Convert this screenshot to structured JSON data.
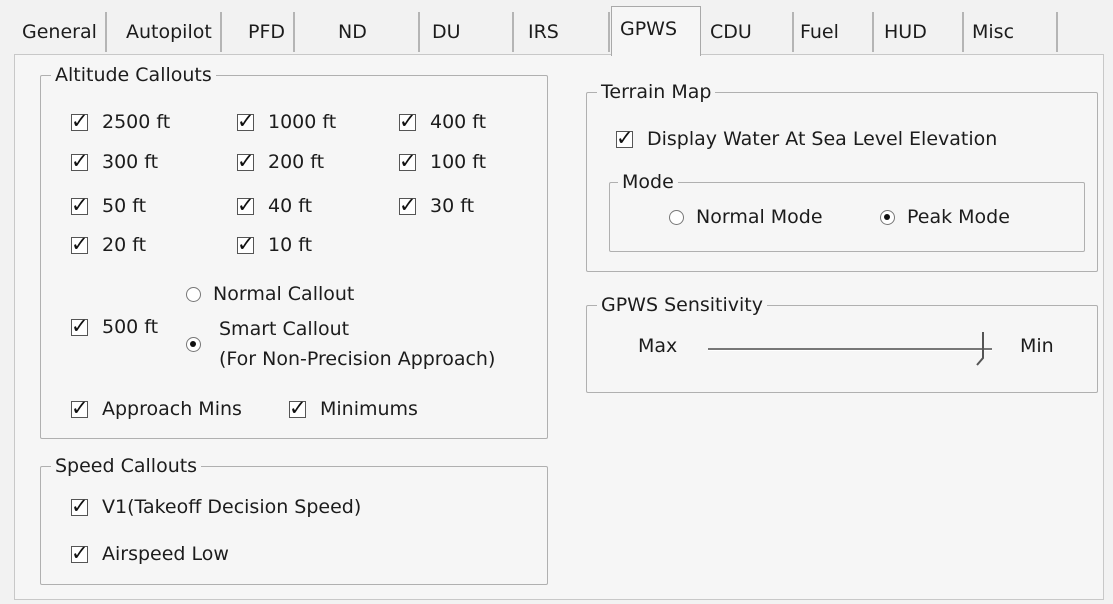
{
  "tabs": [
    {
      "label": "General",
      "active": false
    },
    {
      "label": "Autopilot",
      "active": false
    },
    {
      "label": "PFD",
      "active": false
    },
    {
      "label": "ND",
      "active": false
    },
    {
      "label": "DU",
      "active": false
    },
    {
      "label": "IRS",
      "active": false
    },
    {
      "label": "GPWS",
      "active": true
    },
    {
      "label": "CDU",
      "active": false
    },
    {
      "label": "Fuel",
      "active": false
    },
    {
      "label": "HUD",
      "active": false
    },
    {
      "label": "Misc",
      "active": false
    }
  ],
  "altitude_callouts": {
    "title": "Altitude Callouts",
    "items": [
      {
        "label": "2500 ft",
        "checked": true
      },
      {
        "label": "1000 ft",
        "checked": true
      },
      {
        "label": "400 ft",
        "checked": true
      },
      {
        "label": "300 ft",
        "checked": true
      },
      {
        "label": "200 ft",
        "checked": true
      },
      {
        "label": "100 ft",
        "checked": true
      },
      {
        "label": "50 ft",
        "checked": true
      },
      {
        "label": "40 ft",
        "checked": true
      },
      {
        "label": "30 ft",
        "checked": true
      },
      {
        "label": "20 ft",
        "checked": true
      },
      {
        "label": "10 ft",
        "checked": true
      }
    ],
    "five_hundred": {
      "label": "500 ft",
      "checked": true
    },
    "normal_callout": {
      "label": "Normal Callout",
      "selected": false
    },
    "smart_callout": {
      "label": "Smart Callout",
      "sublabel": "(For Non-Precision Approach)",
      "selected": true
    },
    "approach_mins": {
      "label": "Approach Mins",
      "checked": true
    },
    "minimums": {
      "label": "Minimums",
      "checked": true
    }
  },
  "speed_callouts": {
    "title": "Speed Callouts",
    "v1": {
      "label": "V1(Takeoff Decision Speed)",
      "checked": true
    },
    "airspeed_low": {
      "label": "Airspeed Low",
      "checked": true
    }
  },
  "terrain_map": {
    "title": "Terrain Map",
    "display_water": {
      "label": "Display Water At Sea Level Elevation",
      "checked": true
    },
    "mode": {
      "title": "Mode",
      "normal": {
        "label": "Normal Mode",
        "selected": false
      },
      "peak": {
        "label": "Peak Mode",
        "selected": true
      }
    }
  },
  "gpws_sensitivity": {
    "title": "GPWS Sensitivity",
    "max_label": "Max",
    "min_label": "Min",
    "value_fraction": 0.97
  },
  "check_glyph": "✓"
}
